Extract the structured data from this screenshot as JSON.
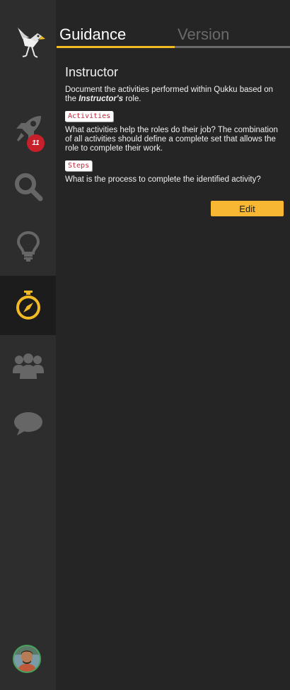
{
  "sidebar": {
    "items": [
      {
        "name": "roadrunner-logo-icon"
      },
      {
        "name": "rocket-icon",
        "badge": "11"
      },
      {
        "name": "search-icon"
      },
      {
        "name": "lightbulb-icon"
      },
      {
        "name": "compass-icon",
        "active": true
      },
      {
        "name": "users-icon"
      },
      {
        "name": "chat-bubble-icon"
      }
    ],
    "badge_count": "11",
    "accent_color": "#f2bb26",
    "badge_color": "#c8202a"
  },
  "tabs": {
    "guidance": "Guidance",
    "version": "Version"
  },
  "guidance": {
    "title": "Instructor",
    "intro_prefix": "Document the activities performed within Qukku based on the ",
    "intro_role": "Instructor's",
    "intro_suffix": " role.",
    "activities_tag": "Activities",
    "activities_text": "What activities help the roles do their job? The combination of all activities should define a complete set that allows the role to complete their work.",
    "steps_tag": "Steps",
    "steps_text": "What is the process to complete the identified activity?",
    "edit_label": "Edit"
  }
}
